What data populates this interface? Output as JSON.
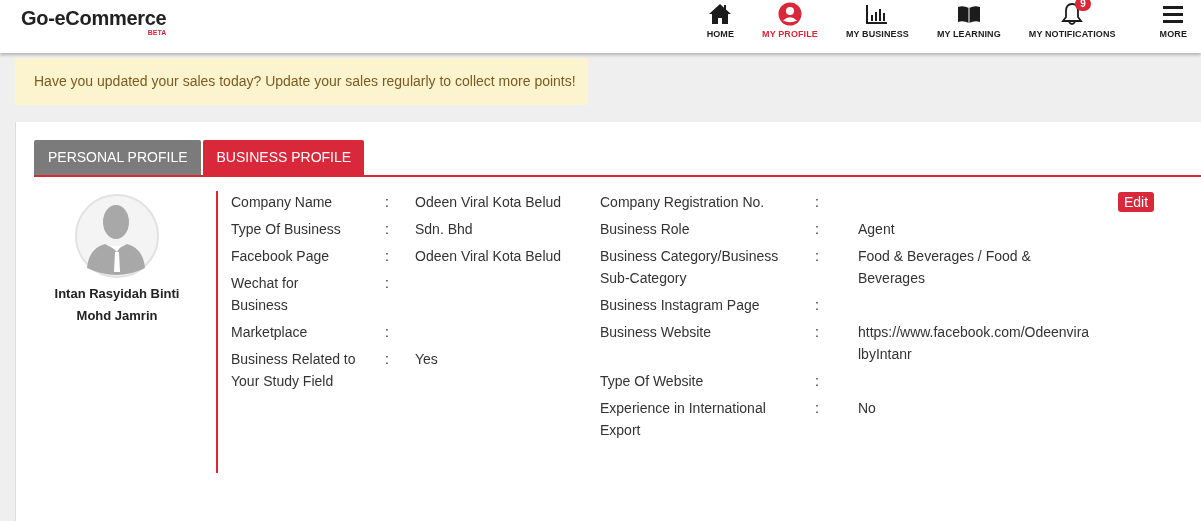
{
  "brand": {
    "name": "Go-eCommerce",
    "tag": "BETA"
  },
  "nav": [
    {
      "label": "HOME",
      "kind": "home",
      "selected": false
    },
    {
      "label": "MY PROFILE",
      "kind": "profile",
      "selected": true
    },
    {
      "label": "MY BUSINESS",
      "kind": "chart",
      "selected": false
    },
    {
      "label": "MY LEARNING",
      "kind": "book",
      "selected": false
    },
    {
      "label": "MY NOTIFICATIONS",
      "kind": "bell",
      "selected": false,
      "badge": "9"
    },
    {
      "label": "MORE",
      "kind": "menu",
      "selected": false
    }
  ],
  "notice": "Have you updated your sales today? Update your sales regularly to collect more points!",
  "tabs": [
    {
      "label": "PERSONAL PROFILE",
      "selected": false
    },
    {
      "label": "BUSINESS PROFILE",
      "selected": true
    }
  ],
  "profile": {
    "name": "Intan Rasyidah Binti Mohd Jamrin"
  },
  "fields_left": [
    {
      "label": "Company Name",
      "value": "Odeen Viral Kota Belud"
    },
    {
      "label": "Type Of Business",
      "value": "Sdn. Bhd"
    },
    {
      "label": "Facebook Page",
      "value": "Odeen Viral Kota Belud"
    },
    {
      "label": "Wechat for Business"
    },
    {
      "label": "Marketplace"
    },
    {
      "label": "Business Related to Your Study Field",
      "value": "Yes"
    }
  ],
  "fields_right": [
    {
      "label": "Company Registration No."
    },
    {
      "label": "Business Role",
      "value": "Agent"
    },
    {
      "label": "Business Category/Business Sub-Category",
      "value": "Food & Beverages / Food & Beverages"
    },
    {
      "label": "Business Instagram Page"
    },
    {
      "label": "Business Website",
      "value": "https://www.facebook.com/OdeenviralbyIntanr"
    },
    {
      "label": "Type Of Website"
    },
    {
      "label": "Experience in International Export",
      "value": "No"
    }
  ],
  "separator": ":",
  "edit_button": "Edit"
}
